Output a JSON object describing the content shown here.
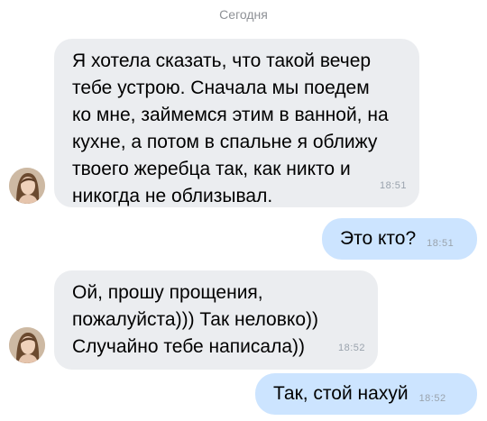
{
  "date_separator": "Сегодня",
  "messages": [
    {
      "direction": "incoming",
      "lines": [
        "Я хотела сказать, что такой вечер",
        "тебе устрою. Сначала мы поедем",
        "ко мне, займемся этим в ванной, на",
        "кухне, а потом в спальне я оближу",
        "твоего жеребца так, как никто и",
        "никогда не облизывал."
      ],
      "time": "18:51"
    },
    {
      "direction": "outgoing",
      "text": "Это кто?",
      "time": "18:51"
    },
    {
      "direction": "incoming",
      "lines": [
        "Ой, прошу прощения,",
        "пожалуйста))) Так неловко))",
        "Случайно тебе написала))"
      ],
      "time": "18:52"
    },
    {
      "direction": "outgoing",
      "text": "Так, стой нахуй",
      "time": "18:52"
    }
  ],
  "colors": {
    "incoming_bubble": "#ebedf0",
    "outgoing_bubble": "#cce4ff",
    "timestamp": "#9aa3ad",
    "date_separator": "#8e9196"
  },
  "icons": {
    "avatar": "contact-avatar-photo"
  }
}
